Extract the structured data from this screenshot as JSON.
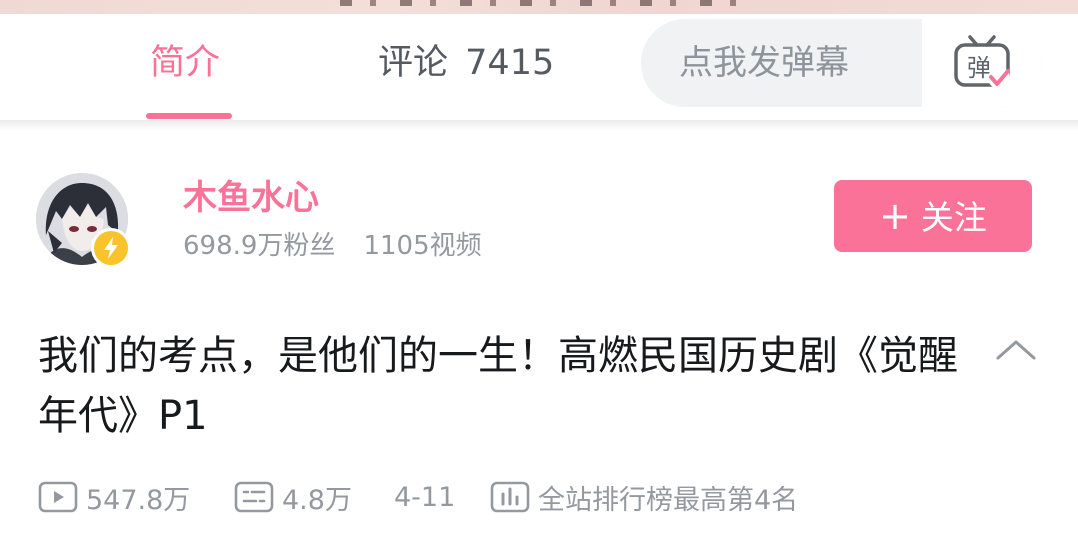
{
  "tabs": {
    "intro_label": "简介",
    "comments_label": "评论",
    "comments_count": "7415",
    "active": "intro"
  },
  "danmaku": {
    "placeholder": "点我发弹幕",
    "button_icon": "danmaku-toggle-icon",
    "button_glyph": "弹"
  },
  "uploader": {
    "name": "木鱼水心",
    "followers": "698.9万粉丝",
    "videos": "1105视频",
    "follow_label": "关注",
    "follow_plus": "+"
  },
  "video": {
    "title": "我们的考点，是他们的一生！高燃民国历史剧《觉醒年代》P1",
    "views": "547.8万",
    "danmaku_count": "4.8万",
    "date": "4-11",
    "rank": "全站排行榜最高第4名"
  },
  "colors": {
    "accent": "#fb7299",
    "text_primary": "#18191c",
    "text_secondary": "#9499a0",
    "badge": "#f9c32c"
  }
}
